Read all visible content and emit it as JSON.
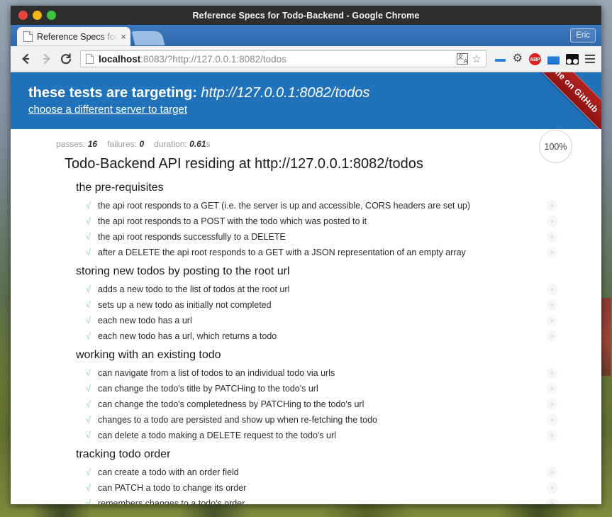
{
  "window": {
    "title": "Reference Specs for Todo-Backend - Google Chrome",
    "controls": {
      "close": "close",
      "minimize": "minimize",
      "maximize": "maximize"
    }
  },
  "tabstrip": {
    "tab": {
      "title": "Reference Specs for",
      "close_label": "×",
      "icon": "page-icon"
    },
    "new_tab_label": "+",
    "profile_label": "Eric"
  },
  "toolbar": {
    "back_label": "←",
    "forward_label": "→",
    "reload_label": "⟳",
    "url_bold": "localhost",
    "url_rest": ":8083/?http://127.0.0.1:8082/todos",
    "url_full": "localhost:8083/?http://127.0.0.1:8082/todos",
    "star_label": "☆",
    "abp_label": "ABP",
    "gear_label": "⚙",
    "menu_label": "menu"
  },
  "banner": {
    "title_prefix": "these tests are targeting:",
    "target_url": "http://127.0.0.1:8082/todos",
    "link_text": "choose a different server to target",
    "ribbon_text": "Fork me on GitHub",
    "bg_color": "#2072bb",
    "ribbon_color": "#a21b1b"
  },
  "stats": {
    "passes_label": "passes:",
    "passes_value": "16",
    "failures_label": "failures:",
    "failures_value": "0",
    "duration_label": "duration:",
    "duration_value": "0.61",
    "duration_unit": "s",
    "percent_badge": "100%"
  },
  "report": {
    "root_suite": "Todo-Backend API residing at http://127.0.0.1:8082/todos",
    "check_color": "#90d5a6",
    "suites": [
      {
        "name": "the pre-requisites",
        "tests": [
          "the api root responds to a GET (i.e. the server is up and accessible, CORS headers are set up)",
          "the api root responds to a POST with the todo which was posted to it",
          "the api root responds successfully to a DELETE",
          "after a DELETE the api root responds to a GET with a JSON representation of an empty array"
        ]
      },
      {
        "name": "storing new todos by posting to the root url",
        "tests": [
          "adds a new todo to the list of todos at the root url",
          "sets up a new todo as initially not completed",
          "each new todo has a url",
          "each new todo has a url, which returns a todo"
        ]
      },
      {
        "name": "working with an existing todo",
        "tests": [
          "can navigate from a list of todos to an individual todo via urls",
          "can change the todo's title by PATCHing to the todo's url",
          "can change the todo's completedness by PATCHing to the todo's url",
          "changes to a todo are persisted and show up when re-fetching the todo",
          "can delete a todo making a DELETE request to the todo's url"
        ]
      },
      {
        "name": "tracking todo order",
        "tests": [
          "can create a todo with an order field",
          "can PATCH a todo to change its order",
          "remembers changes to a todo's order"
        ]
      }
    ]
  }
}
